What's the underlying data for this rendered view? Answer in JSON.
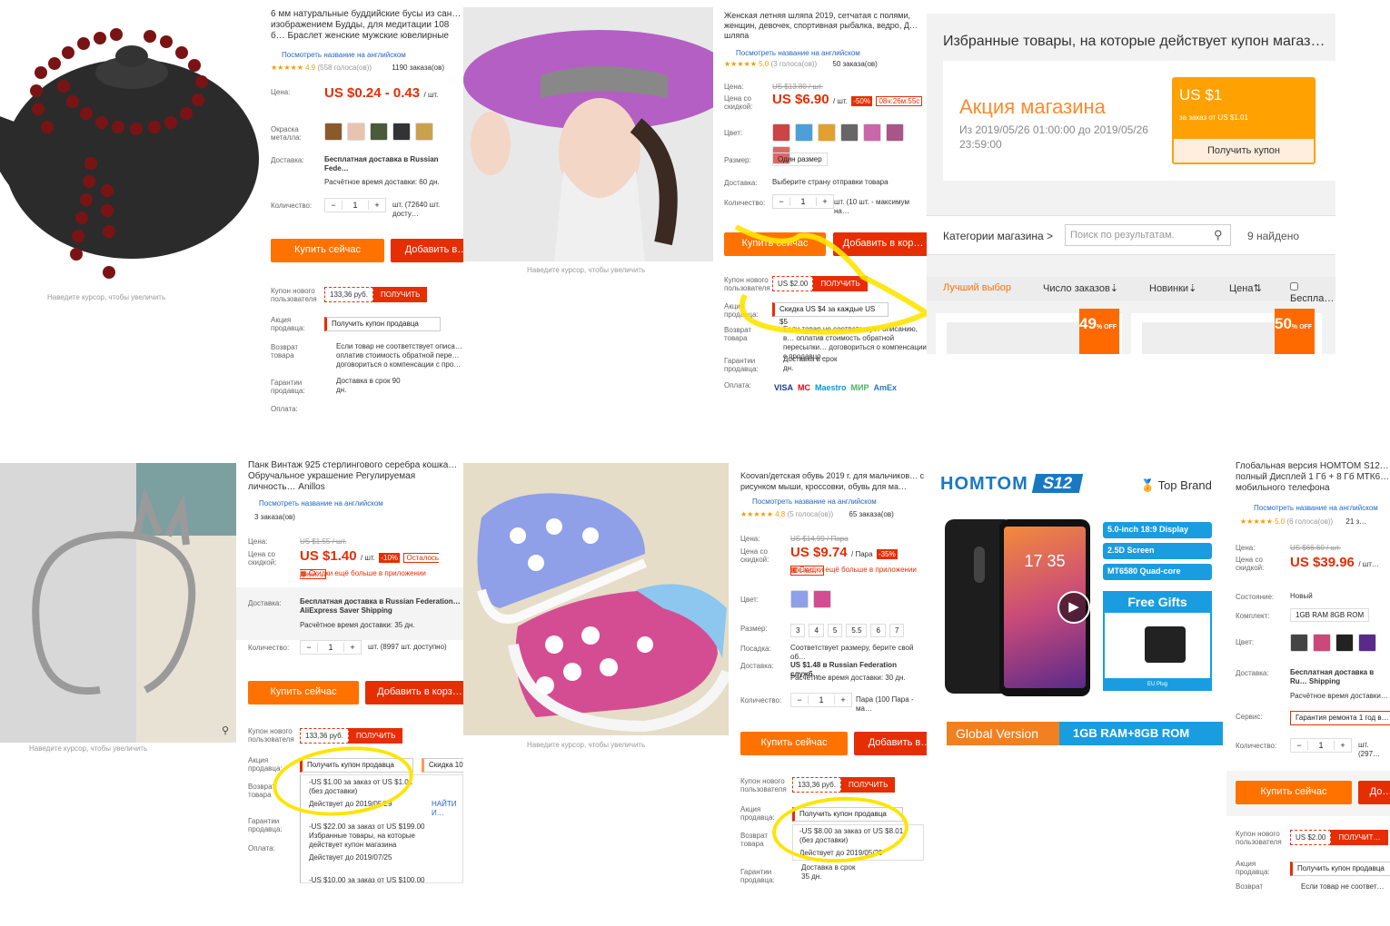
{
  "p1": {
    "title": "6 мм натуральные буддийские бусы из сан… изображением Будды, для медитации 108 б… Браслет женские мужские ювелирные изде…",
    "see_english": "Посмотреть название на английском",
    "rating": "4.9",
    "votes": "(558 голоса(ов))",
    "orders": "1190 заказа(ов)",
    "price_label": "Цена:",
    "price": "US $0.24 - 0.43",
    "per": "/ шт.",
    "color_label": "Окраска металла:",
    "delivery_label": "Доставка:",
    "delivery": "Бесплатная доставка в Russian Fede…",
    "delivery_time": "Расчётное время доставки: 60 дн.",
    "qty_label": "Количество:",
    "qty": "1",
    "qty_avail": "шт. (72640 шт. досту…",
    "buy": "Купить сейчас",
    "add": "Добавить в…",
    "hint": "Наведите курсор, чтобы увеличить",
    "coupon_label": "Купон нового пользователя",
    "coupon_val": "133,36 руб.",
    "get": "ПОЛУЧИТЬ",
    "promo_label": "Акция продавца:",
    "promo": "Получить купон продавца",
    "return_label": "Возврат товара",
    "return_text": "Если товар не соответствует описа… оплатив стоимость обратной пере… договориться о компенсации с про…",
    "guarantee_label": "Гарантии продавца:",
    "guarantee": "Доставка в срок 90 дн.",
    "pay_label": "Оплата:"
  },
  "p2": {
    "title": "Женская летняя шляпа 2019, сетчатая с полями, женщин, девочек, спортивная рыбалка, ведро, Д… шляпа",
    "see_english": "Посмотреть название на английском",
    "rating": "5.0",
    "votes": "(3 голоса(ов))",
    "orders": "50 заказа(ов)",
    "price_label": "Цена:",
    "old_price": "US $13.80 / шт.",
    "disc_label": "Цена со скидкой:",
    "price": "US $6.90",
    "per": "/ шт.",
    "disc": "-50%",
    "timer": "08ч:26м:55с",
    "color_label": "Цвет:",
    "size_label": "Размер:",
    "size": "Один размер",
    "delivery_label": "Доставка:",
    "delivery": "Выберите страну отправки товара",
    "qty_label": "Количество:",
    "qty": "1",
    "qty_avail": "шт. (10 шт. - максимум на…",
    "buy": "Купить сейчас",
    "add": "Добавить в кор…",
    "hint": "Наведите курсор, чтобы увеличить",
    "coupon_label": "Купон нового пользователя",
    "coupon_val": "US $2.00",
    "get": "ПОЛУЧИТЬ",
    "promo_label": "Акция продавца:",
    "promo": "Скидка US $4 за каждые US $5",
    "return_label": "Возврат товара",
    "return_text": "Если товар не соответствует описанию, в… оплатив стоимость обратной пересылки… договориться о компенсации с продавцо…",
    "guarantee_label": "Гарантии продавца:",
    "guarantee": "Доставка в срок дн.",
    "pay_label": "Оплата:"
  },
  "p3": {
    "heading": "Избранные товары, на которые действует купон магаз…",
    "promo_title": "Акция магазина",
    "promo_dates": "Из 2019/05/26 01:00:00 до 2019/05/26 23:59:00",
    "coupon_amount": "US $1",
    "coupon_cond": "за заказ от US $1.01",
    "get_coupon": "Получить купон",
    "categories": "Категории магазина >",
    "search_placeholder": "Поиск по результатам.",
    "found": "9 найдено",
    "sort": [
      "Лучший выбор",
      "Число заказов",
      "Новинки",
      "Цена"
    ],
    "free": "Беспла…",
    "badge1": "49",
    "badge2": "50",
    "off": "OFF"
  },
  "p4": {
    "title": "Панк Винтаж 925 стерлингового серебра кошка… Обручальное украшение Регулируемая личность… Anillos",
    "see_english": "Посмотреть название на английском",
    "orders": "3 заказа(ов)",
    "price_label": "Цена:",
    "old_price": "US $1.55 / шт.",
    "disc_label": "Цена со скидкой:",
    "price": "US $1.40",
    "per": "/ шт.",
    "disc": "-10%",
    "left": "Осталось дней…",
    "app": "Скидки ещё больше в приложении",
    "delivery_label": "Доставка:",
    "delivery": "Бесплатная доставка в Russian Federation… AliExpress Saver Shipping",
    "delivery_time": "Расчётное время доставки: 35 дн.",
    "qty_label": "Количество:",
    "qty": "1",
    "qty_avail": "шт. (8997 шт. доступно)",
    "buy": "Купить сейчас",
    "add": "Добавить в корз…",
    "hint": "Наведите курсор, чтобы увеличить",
    "coupon_label": "Купон нового пользователя",
    "coupon_val": "133,36 руб.",
    "get": "ПОЛУЧИТЬ",
    "promo_label": "Акция продавца:",
    "promo": "Получить купон продавца",
    "promo2": "Скидка 10…",
    "return_label": "Возврат товара",
    "c1": "-US $1.00 за заказ от US $1.01 (без доставки)",
    "c1_until": "Действует до 2019/05/29",
    "find": "НАЙТИ И…",
    "guarantee_label": "Гарантии продавца:",
    "c2": "-US $22.00 за заказ от US $199.00 Избранные товары, на которые действует купон магазина",
    "c2_until": "Действует до 2019/07/25",
    "pay_label": "Оплата:",
    "c3": "-US $10.00 за заказ от US $100.00"
  },
  "p5": {
    "title": "Koovan/детская обувь 2019 г. для мальчиков… с рисунком мыши, кроссовки, обувь для ма…",
    "see_english": "Посмотреть название на английском",
    "rating": "4.8",
    "votes": "(5 голоса(ов))",
    "orders": "65 заказа(ов)",
    "price_label": "Цена:",
    "old_price": "US $14.99 / Пара",
    "disc_label": "Цена со скидкой:",
    "price": "US $9.74",
    "per": "/ Пара",
    "disc": "-35%",
    "left": "Остал…",
    "app": "Скидки ещё больше в приложении",
    "color_label": "Цвет:",
    "size_label": "Размер:",
    "sizes": [
      "3",
      "4",
      "5",
      "5.5",
      "6",
      "7"
    ],
    "fit_label": "Посадка:",
    "fit": "Соответствует размеру, берите свой об…",
    "delivery_label": "Доставка:",
    "delivery": "US $1.48 в Russian Federation служб…",
    "delivery_time": "Расчётное время доставки: 30 дн.",
    "qty_label": "Количество:",
    "qty": "1",
    "qty_avail": "Пара (100 Пара - ма…",
    "buy": "Купить сейчас",
    "add": "Добавить в…",
    "hint": "Наведите курсор, чтобы увеличить",
    "coupon_label": "Купон нового пользователя",
    "coupon_val": "133,36 руб.",
    "get": "ПОЛУЧИТЬ",
    "promo_label": "Акция продавца:",
    "promo": "Получить купон продавца",
    "return_label": "Возврат товара",
    "c1": "-US $8.00 за заказ от US $8.01 (без доставки)",
    "c1_until": "Действует до 2019/05/29",
    "guarantee_label": "Гарантии продавца:",
    "guarantee": "Доставка в срок 35 дн."
  },
  "p6": {
    "brand": "HOMTOM",
    "model": "S12",
    "top_brand": "Top Brand",
    "feat": [
      "5.0-inch 18:9 Display",
      "2.5D Screen",
      "MT6580 Quad-core"
    ],
    "free_gifts": "Free Gifts",
    "eu_plug": "EU Plug",
    "global": "Global Version",
    "mem": "1GB RAM+8GB ROM",
    "screen_time": "17 35",
    "title": "Глобальная версия HOMTOM S12… полный Дисплей 1 Гб + 8 Гб МТК6… мобильного телефона",
    "see_english": "Посмотреть название на английском",
    "rating": "5.0",
    "votes": "(6 голоса(ов))",
    "orders": "21 з…",
    "price_label": "Цена:",
    "old_price": "US $66.60 / шт.",
    "disc_label": "Цена со скидкой:",
    "price": "US $39.96",
    "per": "/ шт…",
    "cond_label": "Состояние:",
    "cond": "Новый",
    "kit_label": "Комплект:",
    "kit": "1GB RAM 8GB ROM",
    "color_label": "Цвет:",
    "delivery_label": "Доставка:",
    "delivery": "Бесплатная доставка в Ru… Shipping",
    "delivery_time": "Расчётное время доставки…",
    "service_label": "Сервис:",
    "service": "Гарантия ремонта 1 год в…",
    "qty_label": "Количество:",
    "qty": "1",
    "qty_avail": "шт. (297…",
    "buy": "Купить сейчас",
    "add": "До…",
    "coupon_label": "Купон нового пользователя",
    "coupon_val": "US $2.00",
    "get": "ПОЛУЧИТ…",
    "promo_label": "Акция продавца:",
    "promo": "Получить купон продавца",
    "return_label": "Возврат",
    "return_text": "Если товар не соответ…"
  },
  "cards": [
    "VISA",
    "MC",
    "Maestro",
    "МИР",
    "AmEx"
  ],
  "colors": {
    "accent": "#ff7200",
    "red": "#e62e04",
    "blue": "#2367c4",
    "yellow": "#ffe400"
  }
}
